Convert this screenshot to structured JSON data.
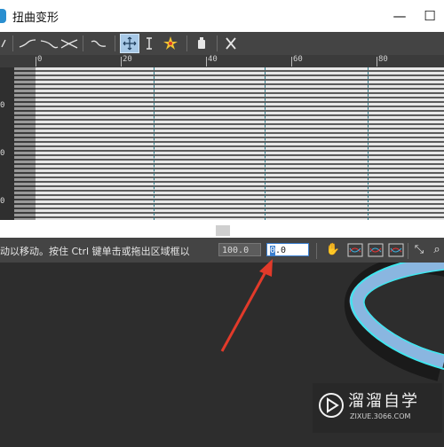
{
  "window": {
    "title": "扭曲变形",
    "min_label": "—",
    "max_label": "☐",
    "accent": "#2a8fd0"
  },
  "toolbar": {
    "icons": [
      "curve-left-icon",
      "curve-ramp-icon",
      "curve-bell-icon",
      "curve-cross-icon",
      "curve-wave-icon",
      "move-icon",
      "scale-vertical-icon",
      "insert-point-icon",
      "reset-curve-icon",
      "delete-point-icon"
    ]
  },
  "ruler": {
    "labels": [
      "0",
      "20",
      "40",
      "60",
      "80"
    ]
  },
  "graph": {
    "y_labels": [
      "0",
      "0",
      "0"
    ]
  },
  "status": {
    "hint": "动以移动。按住 Ctrl 键单击或拖出区域框以",
    "value_x": "100.0",
    "value_y": "0.0",
    "value_y_selected": "0"
  },
  "watermark": {
    "brand": "溜溜自学",
    "url": "ZIXUE.3066.COM"
  },
  "annotation": {
    "arrow_color": "#e23a2a"
  },
  "colors": {
    "selection": "#3a7fd0",
    "curve": "#8ab6e0",
    "curve_edge": "#3fe7ef"
  }
}
